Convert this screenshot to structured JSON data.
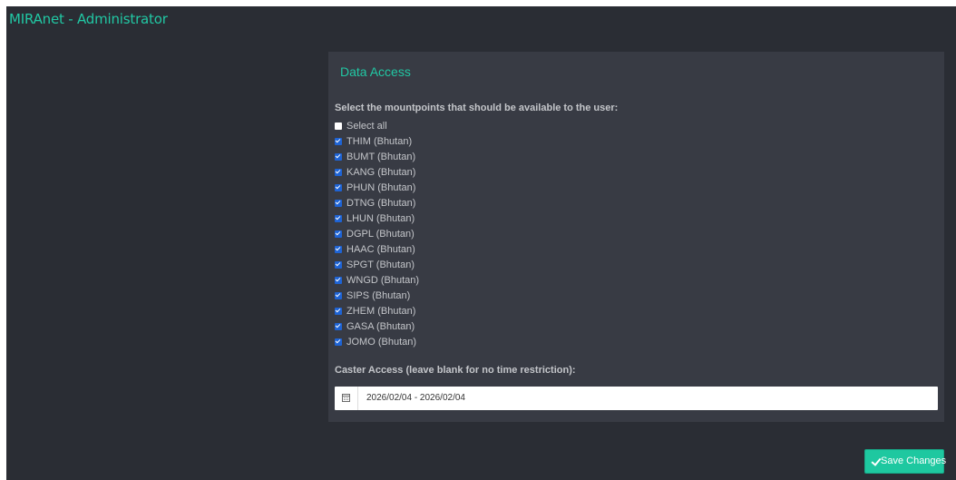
{
  "app": {
    "title": "MIRAnet - Administrator"
  },
  "panel": {
    "title": "Data Access",
    "mountpoints_label": "Select the mountpoints that should be available to the user:",
    "select_all": {
      "label": "Select all",
      "checked": false
    },
    "mountpoints": [
      {
        "label": "THIM (Bhutan)",
        "checked": true
      },
      {
        "label": "BUMT (Bhutan)",
        "checked": true
      },
      {
        "label": "KANG (Bhutan)",
        "checked": true
      },
      {
        "label": "PHUN (Bhutan)",
        "checked": true
      },
      {
        "label": "DTNG (Bhutan)",
        "checked": true
      },
      {
        "label": "LHUN (Bhutan)",
        "checked": true
      },
      {
        "label": "DGPL (Bhutan)",
        "checked": true
      },
      {
        "label": "HAAC (Bhutan)",
        "checked": true
      },
      {
        "label": "SPGT (Bhutan)",
        "checked": true
      },
      {
        "label": "WNGD (Bhutan)",
        "checked": true
      },
      {
        "label": "SIPS (Bhutan)",
        "checked": true
      },
      {
        "label": "ZHEM (Bhutan)",
        "checked": true
      },
      {
        "label": "GASA (Bhutan)",
        "checked": true
      },
      {
        "label": "JOMO (Bhutan)",
        "checked": true
      }
    ],
    "caster_access_label": "Caster Access (leave blank for no time restriction):",
    "date_range": {
      "value": "2026/02/04 - 2026/02/04",
      "icon": "calendar-icon"
    }
  },
  "actions": {
    "save_label": "Save Changes",
    "save_icon": "check-icon"
  },
  "colors": {
    "background": "#2a2d34",
    "panel": "#383b44",
    "accent": "#21c8a4",
    "checkbox_checked": "#1e63d4",
    "button": "#1ec8a0"
  }
}
